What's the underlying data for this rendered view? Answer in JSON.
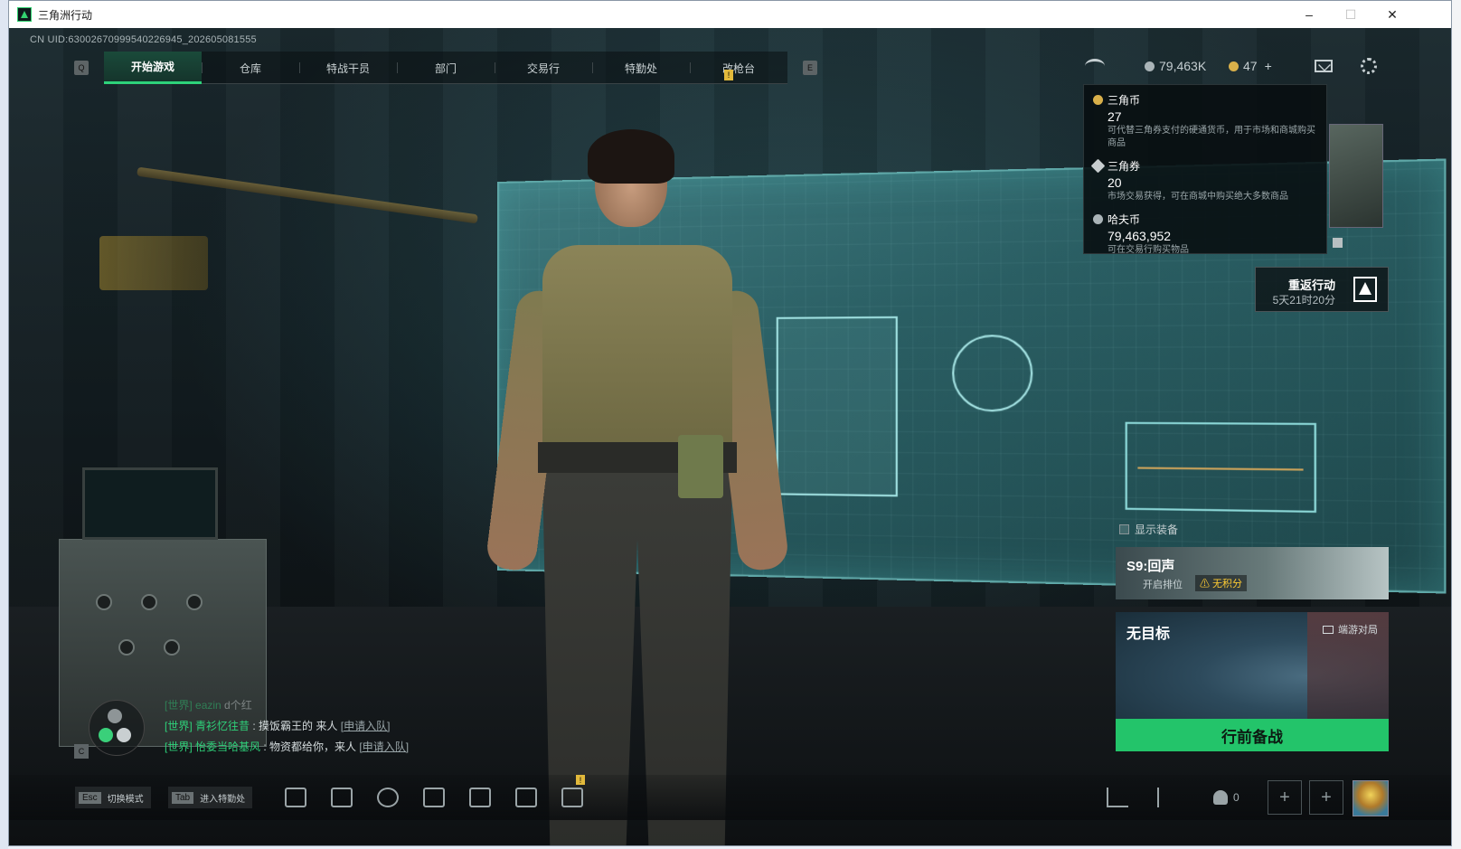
{
  "window": {
    "title": "三角洲行动",
    "minimize": "–",
    "maximize": "☐",
    "close": "✕"
  },
  "uid": "CN UID:6300267099954022694​5_202605081555",
  "nav": {
    "left_key": "Q",
    "right_key": "E",
    "badge": "!",
    "tabs": [
      "开始游戏",
      "仓库",
      "特战干员",
      "部门",
      "交易行",
      "特勤处",
      "改枪台"
    ],
    "active_index": 0
  },
  "hud": {
    "haf_short": "79,463K",
    "triangle_coin_short": "47",
    "plus": "+",
    "colors": {
      "accent": "#2ed27a",
      "coin_gold": "#d9b04a",
      "coin_silver": "#aab4b8"
    }
  },
  "currency_panel": {
    "items": [
      {
        "icon": "triangle-coin-icon",
        "name": "三角币",
        "value": "27",
        "desc": "可代替三角券支付的硬通货币，用于市场和商城购买商品"
      },
      {
        "icon": "triangle-ticket-icon",
        "name": "三角券",
        "value": "20",
        "desc": "市场交易获得，可在商城中购买绝大多数商品"
      },
      {
        "icon": "haf-coin-icon",
        "name": "哈夫币",
        "value": "79,463,952",
        "desc": "可在交易行购买物品"
      }
    ]
  },
  "return_action": {
    "title": "重返行动",
    "time": "5天21时20分"
  },
  "show_equipment": "显示装备",
  "season": {
    "title": "S9:回声",
    "sub": "开启排位",
    "badge": "⚠ 无积分"
  },
  "map_card": {
    "title": "无目标",
    "mode": "端游对局"
  },
  "start_button": "行前备战",
  "chat": [
    {
      "channel": "[世界]",
      "name": "eazin",
      "msg": "d个红",
      "action": "",
      "dim": true
    },
    {
      "channel": "[世界]",
      "name": "青衫忆往昔",
      "msg": ": 摸饭霸王的 来人",
      "action": "[申请入队]",
      "dim": false
    },
    {
      "channel": "[世界]",
      "name": "怡委当哈基风",
      "msg": ": 物资都给你，来人",
      "action": "[申请入队]",
      "dim": false
    }
  ],
  "joystick_key": "C",
  "bottom": {
    "esc_key": "Esc",
    "esc_label": "切换模式",
    "tab_key": "Tab",
    "tab_label": "进入特勤处",
    "flag": "!",
    "friends_count": "0",
    "slot_plus": "+"
  }
}
